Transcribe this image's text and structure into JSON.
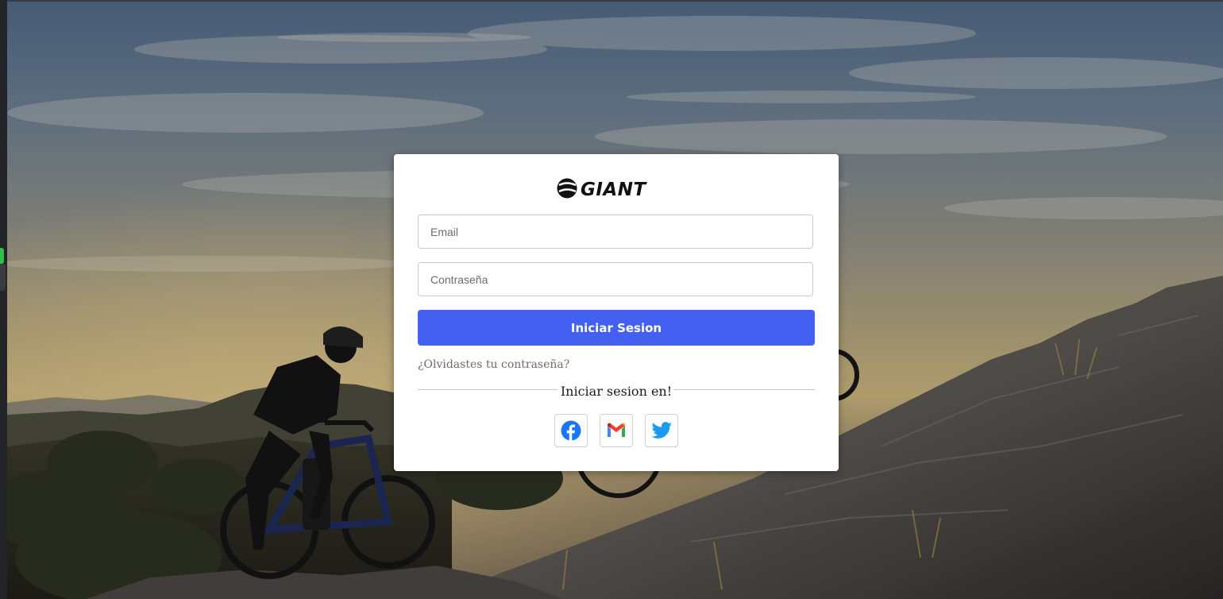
{
  "brand": {
    "logo_text": "GIANT"
  },
  "login_form": {
    "email_placeholder": "Email",
    "password_placeholder": "Contraseña",
    "submit_label": "Iniciar Sesion",
    "forgot_password_link": "¿Olvidastes tu contraseña?",
    "social_divider_label": "Iniciar sesion en!"
  },
  "social_logins": [
    {
      "name": "facebook",
      "icon": "facebook-icon",
      "color": "#1877f2"
    },
    {
      "name": "gmail",
      "icon": "gmail-icon",
      "color": "#ea4335"
    },
    {
      "name": "twitter",
      "icon": "twitter-icon",
      "color": "#1d9bf0"
    }
  ],
  "colors": {
    "primary_button": "#4460f1",
    "card_background": "#ffffff",
    "link_text": "#6c6c6c"
  }
}
